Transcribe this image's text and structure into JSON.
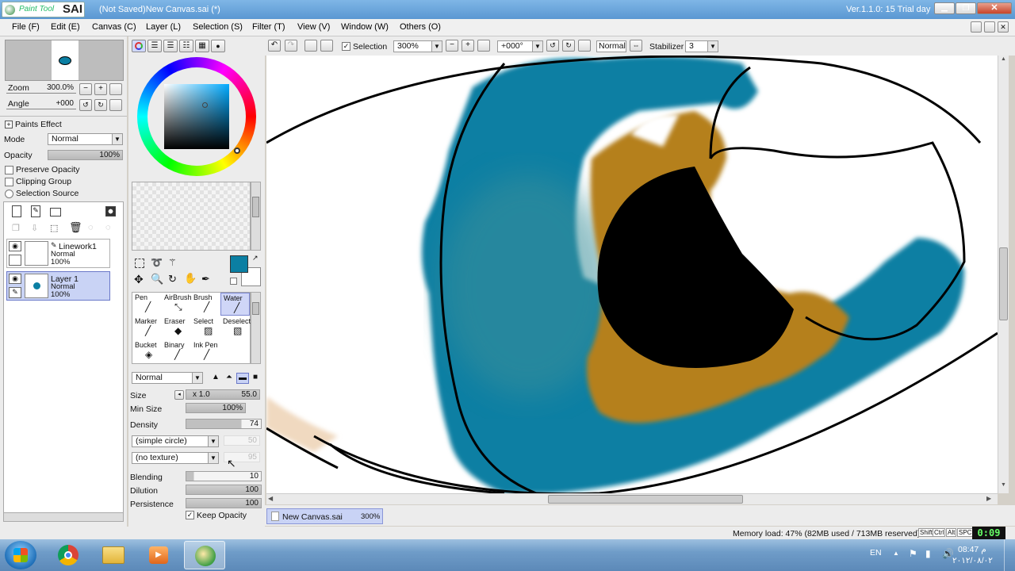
{
  "app": {
    "logo_text": "Paint Tool",
    "logo_brand": "SAI",
    "window_title": "(Not Saved)New Canvas.sai (*)",
    "version": "Ver.1.1.0: 15 Trial day"
  },
  "menu": [
    "File (F)",
    "Edit (E)",
    "Canvas (C)",
    "Layer (L)",
    "Selection (S)",
    "Filter (T)",
    "View (V)",
    "Window (W)",
    "Others (O)"
  ],
  "navigator": {
    "zoom_label": "Zoom",
    "zoom_value": "300.0%",
    "angle_label": "Angle",
    "angle_value": "+000"
  },
  "layer_props": {
    "paints_effect": "Paints Effect",
    "mode_label": "Mode",
    "mode_value": "Normal",
    "opacity_label": "Opacity",
    "opacity_value": "100%",
    "opacity_level": 1.0,
    "preserve_opacity": "Preserve Opacity",
    "clipping_group": "Clipping Group",
    "selection_source": "Selection Source"
  },
  "layers": [
    {
      "name": "Linework1",
      "mode": "Normal",
      "opacity": "100%",
      "selected": false
    },
    {
      "name": "Layer 1",
      "mode": "Normal",
      "opacity": "100%",
      "selected": true
    }
  ],
  "colors": {
    "primary": "#0b7fa3",
    "secondary": "#ffffff",
    "blue_paint": "#0b7fa3",
    "orange_paint": "#b5801e",
    "selection_bg": "#c9d3f5"
  },
  "tools": [
    {
      "name": "Pen",
      "icon": "pen-icon"
    },
    {
      "name": "AirBrush",
      "icon": "airbrush-icon"
    },
    {
      "name": "Brush",
      "icon": "brush-icon"
    },
    {
      "name": "Water",
      "icon": "water-icon",
      "selected": true
    },
    {
      "name": "Marker",
      "icon": "marker-icon"
    },
    {
      "name": "Eraser",
      "icon": "eraser-icon"
    },
    {
      "name": "Select",
      "icon": "select-icon"
    },
    {
      "name": "Deselect",
      "icon": "deselect-icon"
    },
    {
      "name": "Bucket",
      "icon": "bucket-icon"
    },
    {
      "name": "Binary",
      "icon": "binary-icon"
    },
    {
      "name": "Ink Pen",
      "icon": "ink-pen-icon"
    }
  ],
  "brush": {
    "blend_mode": "Normal",
    "size_label": "Size",
    "size_mult": "x 1.0",
    "size_value": "55.0",
    "min_size_label": "Min Size",
    "min_size_value": "100%",
    "density_label": "Density",
    "density_value": "74",
    "shape": "(simple circle)",
    "shape_value": "50",
    "texture": "(no texture)",
    "texture_value": "95",
    "blending_label": "Blending",
    "blending_value": "10",
    "dilution_label": "Dilution",
    "dilution_value": "100",
    "persistence_label": "Persistence",
    "persistence_value": "100",
    "keep_opacity": "Keep Opacity"
  },
  "canvas_toolbar": {
    "selection_label": "Selection",
    "zoom": "300%",
    "angle": "+000°",
    "mode": "Normal",
    "stabilizer_label": "Stabilizer",
    "stabilizer_value": "3"
  },
  "canvas_tab": {
    "name": "New Canvas.sai",
    "zoom": "300%"
  },
  "status": {
    "memory": "Memory load: 47% (82MB used / 713MB reserved)",
    "keys": [
      "Shift",
      "Ctrl",
      "Alt",
      "SPC"
    ],
    "timer": "0:09"
  },
  "taskbar": {
    "lang": "EN",
    "time": "08:47 م",
    "date": "٢٠١٢/٠٨/٠٢"
  }
}
